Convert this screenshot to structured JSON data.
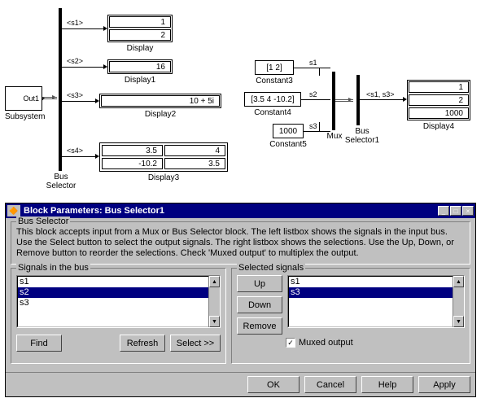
{
  "diagram": {
    "subsystem": {
      "port_label": "Out1",
      "caption": "Subsystem"
    },
    "bus_selector": {
      "caption": "Bus\nSelector",
      "signals": [
        "<s1>",
        "<s2>",
        "<s3>",
        "<s4>"
      ]
    },
    "displays": {
      "display": {
        "caption": "Display",
        "values": [
          "1",
          "2"
        ]
      },
      "display1": {
        "caption": "Display1",
        "value": "16"
      },
      "display2": {
        "caption": "Display2",
        "value": "10 + 5i"
      },
      "display3": {
        "caption": "Display3",
        "row1": [
          "3.5",
          "4"
        ],
        "row2": [
          "-10.2",
          "3.5"
        ]
      },
      "display4": {
        "caption": "Display4",
        "values": [
          "1",
          "2",
          "1000"
        ]
      }
    },
    "constants": {
      "constant3": {
        "caption": "Constant3",
        "value": "[1  2]"
      },
      "constant4": {
        "caption": "Constant4",
        "value": "[3.5 4 -10.2]"
      },
      "constant5": {
        "caption": "Constant5",
        "value": "1000"
      }
    },
    "mux": {
      "caption": "Mux"
    },
    "bus_selector1": {
      "caption": "Bus\nSelector1",
      "out_label": "<s1, s3>"
    },
    "sig_right": {
      "s1": "s1",
      "s2": "s2",
      "s3": "s3"
    }
  },
  "dialog": {
    "title": "Block Parameters: Bus Selector1",
    "section_label": "Bus Selector",
    "description": "This block accepts input from a Mux or Bus Selector block. The left listbox shows the signals in the input bus. Use the Select button to select the output signals. The right listbox shows the selections. Use the Up, Down, or Remove button to reorder the selections. Check 'Muxed output' to multiplex the output.",
    "signals_label": "Signals in the bus",
    "selected_label": "Selected signals",
    "signals_list": [
      "s1",
      "s2",
      "s3"
    ],
    "signals_selected_index": 1,
    "selected_list": [
      "s1",
      "s3"
    ],
    "selected_selected_index": 1,
    "buttons": {
      "find": "Find",
      "refresh": "Refresh",
      "select": "Select >>",
      "up": "Up",
      "down": "Down",
      "remove": "Remove",
      "ok": "OK",
      "cancel": "Cancel",
      "help": "Help",
      "apply": "Apply"
    },
    "muxed_label": "Muxed output",
    "muxed_checked": true,
    "titlebar_icons": {
      "min": "_",
      "max": "□",
      "close": "×"
    }
  }
}
